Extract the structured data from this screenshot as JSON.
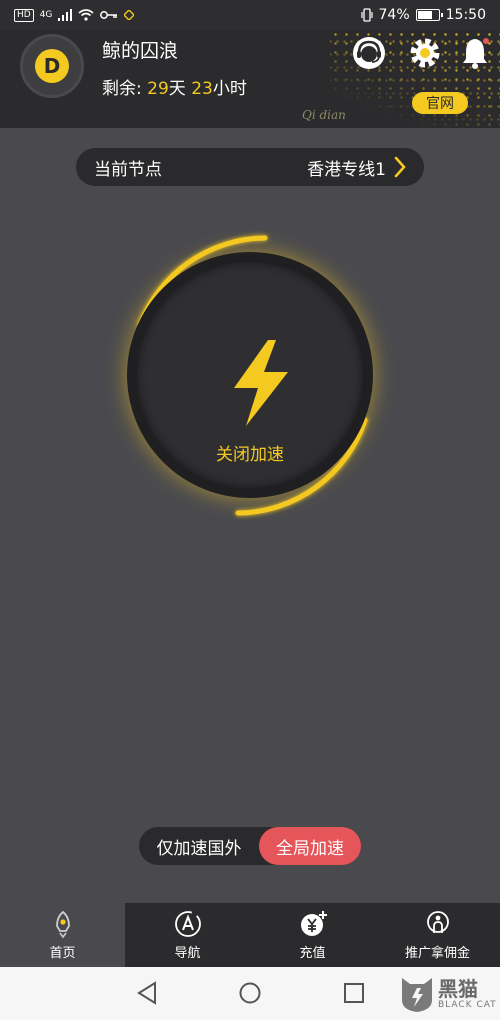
{
  "status_bar": {
    "network": "4G",
    "badge": "HD",
    "battery": "74%",
    "battery_level": 0.74,
    "time": "15:50"
  },
  "header": {
    "username": "鲸的囚浪",
    "remain_label": "剩余:",
    "days": "29",
    "days_unit": "天",
    "hours": "23",
    "hours_unit": "小时",
    "tagline": "Qi dian",
    "official_label": "官网",
    "logo_letter": "D"
  },
  "node": {
    "label": "当前节点",
    "value": "香港专线1"
  },
  "accelerator": {
    "label": "关闭加速"
  },
  "mode": {
    "options": [
      "仅加速国外",
      "全局加速"
    ],
    "selected": "全局加速"
  },
  "tabs": [
    {
      "label": "首页",
      "icon": "rocket-icon"
    },
    {
      "label": "导航",
      "icon": "compass-icon"
    },
    {
      "label": "充值",
      "icon": "recharge-icon"
    },
    {
      "label": "推广拿佣金",
      "icon": "share-icon"
    }
  ],
  "watermark": {
    "cn": "黑猫",
    "en": "BLACK CAT"
  },
  "colors": {
    "accent": "#f4c920",
    "active_mode": "#e4565a",
    "background": "#4a4a4e",
    "header": "#2b2b2d"
  }
}
